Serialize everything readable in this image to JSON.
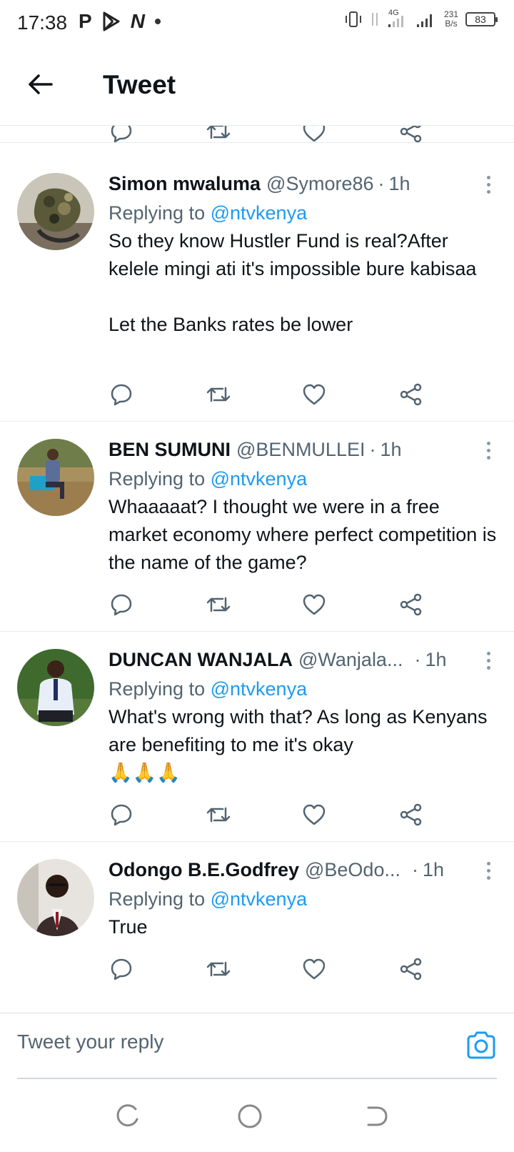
{
  "status_bar": {
    "time": "17:38",
    "network": "4G",
    "net_speed_value": "231",
    "net_speed_unit": "B/s",
    "battery": "83"
  },
  "header": {
    "title": "Tweet"
  },
  "tweets": [
    {
      "name": "Simon mwaluma",
      "handle": "@Symore86",
      "time": "1h",
      "replying_label": "Replying to",
      "mention": "@ntvkenya",
      "text": "So they know Hustler Fund is real?After kelele mingi ati it's impossible bure kabisaa\n\nLet the Banks rates be lower"
    },
    {
      "name": "BEN SUMUNI",
      "handle": "@BENMULLEI",
      "time": "1h",
      "replying_label": "Replying to",
      "mention": "@ntvkenya",
      "text": "Whaaaaat? I thought we were in a free market economy where perfect competition is the name of the game?"
    },
    {
      "name": "DUNCAN WANJALA",
      "handle": "@Wanjala...",
      "time": "1h",
      "replying_label": "Replying to",
      "mention": "@ntvkenya",
      "text": "What's wrong with that? As long as Kenyans are benefiting to me it's okay\n🙏🙏🙏"
    },
    {
      "name": "Odongo B.E.Godfrey",
      "handle": "@BeOdo...",
      "time": "1h",
      "replying_label": "Replying to",
      "mention": "@ntvkenya",
      "text": "True"
    }
  ],
  "reply_bar": {
    "placeholder": "Tweet your reply"
  },
  "colors": {
    "accent": "#1d9bf0",
    "text_primary": "#0f1419",
    "text_secondary": "#536471",
    "icon": "#536471",
    "divider": "#e6ecf0"
  },
  "icons": {
    "reply": "reply-icon",
    "retweet": "retweet-icon",
    "like": "heart-icon",
    "share": "share-icon",
    "camera": "camera-icon",
    "back": "back-arrow-icon"
  }
}
